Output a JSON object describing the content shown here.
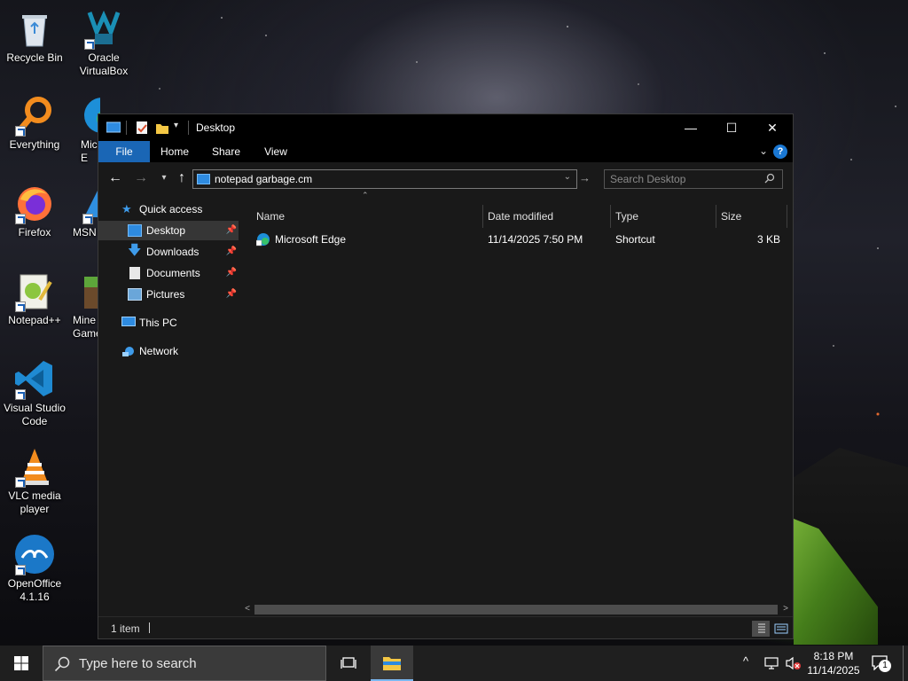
{
  "desktop": {
    "icons": [
      {
        "label": "Recycle Bin"
      },
      {
        "label": "Oracle VirtualBox"
      },
      {
        "label": "Everything"
      },
      {
        "label": "Mic E"
      },
      {
        "label": "Firefox"
      },
      {
        "label": "MSN"
      },
      {
        "label": "Notepad++"
      },
      {
        "label": "Mine Game"
      },
      {
        "label": "Visual Studio Code"
      },
      {
        "label": "VLC media player"
      },
      {
        "label": "OpenOffice 4.1.16"
      }
    ]
  },
  "window": {
    "title": "Desktop",
    "controls": {
      "minimize": "—",
      "maximize": "☐",
      "close": "✕"
    },
    "ribbon_tabs": [
      "File",
      "Home",
      "Share",
      "View"
    ],
    "help": "?",
    "address_value": "notepad garbage.cm",
    "search_placeholder": "Search Desktop",
    "nav": {
      "quick_access": "Quick access",
      "desktop": "Desktop",
      "downloads": "Downloads",
      "documents": "Documents",
      "pictures": "Pictures",
      "this_pc": "This PC",
      "network": "Network"
    },
    "columns": {
      "name": "Name",
      "date": "Date modified",
      "type": "Type",
      "size": "Size"
    },
    "files": [
      {
        "name": "Microsoft Edge",
        "date": "11/14/2025 7:50 PM",
        "type": "Shortcut",
        "size": "3 KB"
      }
    ],
    "status": "1 item"
  },
  "taskbar": {
    "search_placeholder": "Type here to search",
    "time": "8:18 PM",
    "date": "11/14/2025",
    "notifications": "1"
  }
}
